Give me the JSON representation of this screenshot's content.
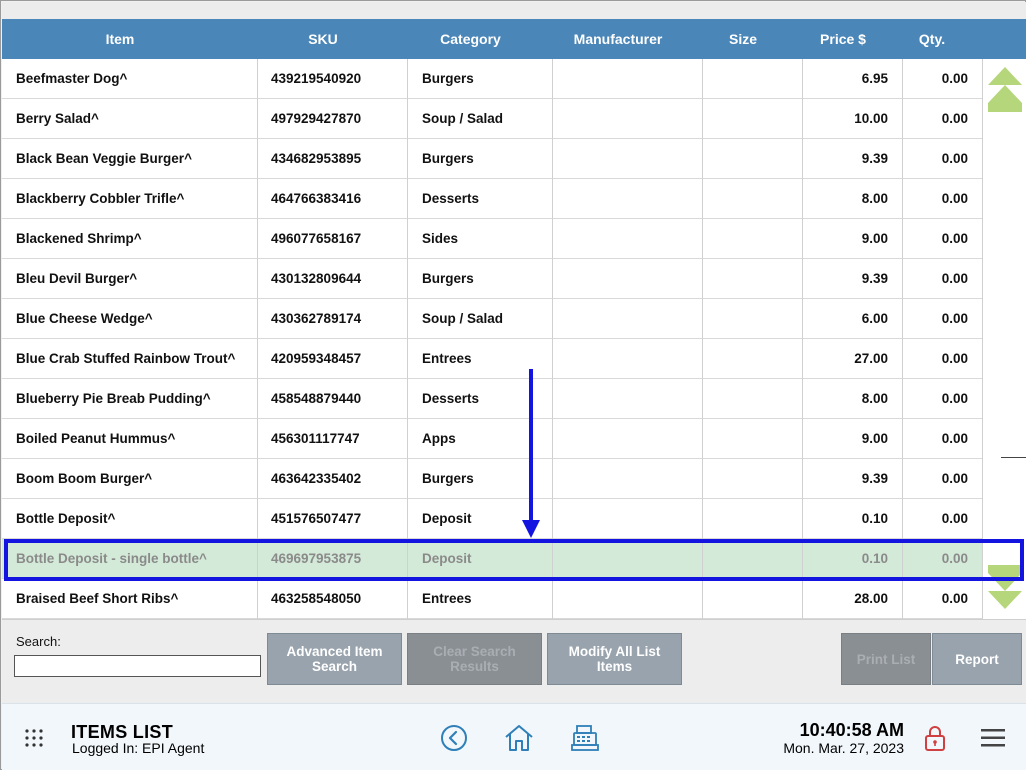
{
  "columns": [
    "Item",
    "SKU",
    "Category",
    "Manufacturer",
    "Size",
    "Price $",
    "Qty."
  ],
  "rows": [
    {
      "item": "Beefmaster Dog^",
      "sku": "439219540920",
      "category": "Burgers",
      "manufacturer": "",
      "size": "",
      "price": "6.95",
      "qty": "0.00"
    },
    {
      "item": "Berry Salad^",
      "sku": "497929427870",
      "category": "Soup / Salad",
      "manufacturer": "",
      "size": "",
      "price": "10.00",
      "qty": "0.00"
    },
    {
      "item": "Black Bean Veggie Burger^",
      "sku": "434682953895",
      "category": "Burgers",
      "manufacturer": "",
      "size": "",
      "price": "9.39",
      "qty": "0.00"
    },
    {
      "item": "Blackberry Cobbler Trifle^",
      "sku": "464766383416",
      "category": "Desserts",
      "manufacturer": "",
      "size": "",
      "price": "8.00",
      "qty": "0.00"
    },
    {
      "item": "Blackened Shrimp^",
      "sku": "496077658167",
      "category": "Sides",
      "manufacturer": "",
      "size": "",
      "price": "9.00",
      "qty": "0.00"
    },
    {
      "item": "Bleu Devil Burger^",
      "sku": "430132809644",
      "category": "Burgers",
      "manufacturer": "",
      "size": "",
      "price": "9.39",
      "qty": "0.00"
    },
    {
      "item": "Blue Cheese Wedge^",
      "sku": "430362789174",
      "category": "Soup / Salad",
      "manufacturer": "",
      "size": "",
      "price": "6.00",
      "qty": "0.00"
    },
    {
      "item": "Blue Crab Stuffed Rainbow Trout^",
      "sku": "420959348457",
      "category": "Entrees",
      "manufacturer": "",
      "size": "",
      "price": "27.00",
      "qty": "0.00"
    },
    {
      "item": "Blueberry Pie Breab Pudding^",
      "sku": "458548879440",
      "category": "Desserts",
      "manufacturer": "",
      "size": "",
      "price": "8.00",
      "qty": "0.00"
    },
    {
      "item": "Boiled Peanut Hummus^",
      "sku": "456301117747",
      "category": "Apps",
      "manufacturer": "",
      "size": "",
      "price": "9.00",
      "qty": "0.00"
    },
    {
      "item": "Boom Boom Burger^",
      "sku": "463642335402",
      "category": "Burgers",
      "manufacturer": "",
      "size": "",
      "price": "9.39",
      "qty": "0.00"
    },
    {
      "item": "Bottle Deposit^",
      "sku": "451576507477",
      "category": "Deposit",
      "manufacturer": "",
      "size": "",
      "price": "0.10",
      "qty": "0.00"
    },
    {
      "item": "Bottle Deposit - single bottle^",
      "sku": "469697953875",
      "category": "Deposit",
      "manufacturer": "",
      "size": "",
      "price": "0.10",
      "qty": "0.00"
    },
    {
      "item": "Braised Beef Short Ribs^",
      "sku": "463258548050",
      "category": "Entrees",
      "manufacturer": "",
      "size": "",
      "price": "28.00",
      "qty": "0.00"
    }
  ],
  "selected_row": 12,
  "toolbar": {
    "search_label": "Search:",
    "search_value": "",
    "advanced_search": "Advanced Item Search",
    "clear_search": "Clear Search Results",
    "modify_all": "Modify All List Items",
    "print_list": "Print List",
    "report": "Report"
  },
  "status": {
    "title": "ITEMS LIST",
    "logged_in": "Logged In:  EPI Agent",
    "time": "10:40:58 AM",
    "date": "Mon. Mar. 27, 2023"
  },
  "colors": {
    "header": "#4a86b8",
    "selected_row": "#d4ead8",
    "annotation": "#1414e0",
    "scroll_arrows": "#b5d67a",
    "icon_blue": "#2f7fb8",
    "lock_red": "#d04040"
  },
  "icons": [
    "grid-menu-icon",
    "back-circle-icon",
    "home-icon",
    "cash-register-icon",
    "lock-icon",
    "hamburger-menu-icon",
    "scroll-up-icon",
    "scroll-down-icon"
  ]
}
